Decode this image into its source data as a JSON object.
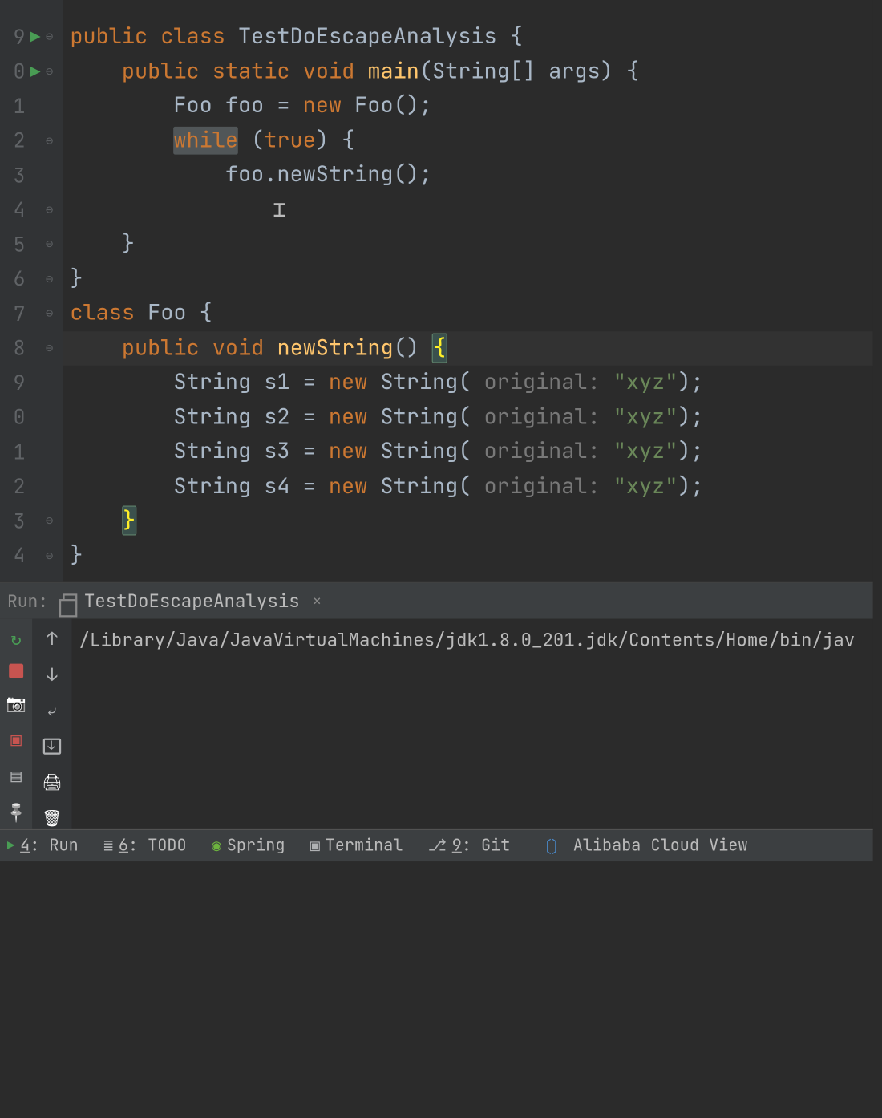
{
  "editor": {
    "lines": [
      {
        "num": "9",
        "run": true,
        "fold": "⊖",
        "tokens": [
          [
            "kw",
            "public"
          ],
          [
            "op",
            " "
          ],
          [
            "kw",
            "class"
          ],
          [
            "op",
            " "
          ],
          [
            "cls",
            "TestDoEscapeAnalysis"
          ],
          [
            "op",
            " {"
          ]
        ]
      },
      {
        "num": "0",
        "run": true,
        "fold": "⊖",
        "tokens": [
          [
            "op",
            "    "
          ],
          [
            "kw",
            "public"
          ],
          [
            "op",
            " "
          ],
          [
            "kw",
            "static"
          ],
          [
            "op",
            " "
          ],
          [
            "kw",
            "void"
          ],
          [
            "op",
            " "
          ],
          [
            "fn",
            "main"
          ],
          [
            "op",
            "(String[] "
          ],
          [
            "param",
            "args"
          ],
          [
            "op",
            ") {"
          ]
        ]
      },
      {
        "num": "1",
        "run": false,
        "fold": "",
        "tokens": [
          [
            "op",
            "        Foo foo = "
          ],
          [
            "kw",
            "new"
          ],
          [
            "op",
            " Foo();"
          ]
        ]
      },
      {
        "num": "2",
        "run": false,
        "fold": "⊖",
        "tokens": [
          [
            "op",
            "        "
          ],
          [
            "kw-while",
            "while"
          ],
          [
            "op",
            " ("
          ],
          [
            "kw",
            "true"
          ],
          [
            "op",
            ") {"
          ]
        ]
      },
      {
        "num": "3",
        "run": false,
        "fold": "",
        "tokens": [
          [
            "op",
            "            foo.newString();"
          ]
        ]
      },
      {
        "num": "4",
        "run": false,
        "fold": "⊖",
        "tokens": [
          [
            "op",
            "        "
          ]
        ]
      },
      {
        "num": "5",
        "run": false,
        "fold": "⊖",
        "tokens": [
          [
            "op",
            "    }"
          ]
        ]
      },
      {
        "num": "6",
        "run": false,
        "fold": "⊖",
        "tokens": [
          [
            "op",
            "}"
          ]
        ]
      },
      {
        "num": "7",
        "run": false,
        "fold": "⊖",
        "tokens": [
          [
            "kw",
            "class"
          ],
          [
            "op",
            " "
          ],
          [
            "cls",
            "Foo"
          ],
          [
            "op",
            " {"
          ]
        ]
      },
      {
        "num": "8",
        "run": false,
        "fold": "⊖",
        "hl": true,
        "tokens": [
          [
            "op",
            "    "
          ],
          [
            "kw",
            "public"
          ],
          [
            "op",
            " "
          ],
          [
            "kw",
            "void"
          ],
          [
            "op",
            " "
          ],
          [
            "fn",
            "newString"
          ],
          [
            "op",
            "() "
          ],
          [
            "brace-match",
            "{"
          ]
        ]
      },
      {
        "num": "9",
        "run": false,
        "fold": "",
        "tokens": [
          [
            "op",
            "        String s1 = "
          ],
          [
            "kw",
            "new"
          ],
          [
            "op",
            " String( "
          ],
          [
            "hint",
            "original: "
          ],
          [
            "str",
            "\"xyz\""
          ],
          [
            "op",
            ");"
          ]
        ]
      },
      {
        "num": "0",
        "run": false,
        "fold": "",
        "tokens": [
          [
            "op",
            "        String s2 = "
          ],
          [
            "kw",
            "new"
          ],
          [
            "op",
            " String( "
          ],
          [
            "hint",
            "original: "
          ],
          [
            "str",
            "\"xyz\""
          ],
          [
            "op",
            ");"
          ]
        ]
      },
      {
        "num": "1",
        "run": false,
        "fold": "",
        "tokens": [
          [
            "op",
            "        String s3 = "
          ],
          [
            "kw",
            "new"
          ],
          [
            "op",
            " String( "
          ],
          [
            "hint",
            "original: "
          ],
          [
            "str",
            "\"xyz\""
          ],
          [
            "op",
            ");"
          ]
        ]
      },
      {
        "num": "2",
        "run": false,
        "fold": "",
        "tokens": [
          [
            "op",
            "        String s4 = "
          ],
          [
            "kw",
            "new"
          ],
          [
            "op",
            " String( "
          ],
          [
            "hint",
            "original: "
          ],
          [
            "str",
            "\"xyz\""
          ],
          [
            "op",
            ");"
          ]
        ]
      },
      {
        "num": "3",
        "run": false,
        "fold": "⊖",
        "tokens": [
          [
            "op",
            "    "
          ],
          [
            "brace-match brace-yellow",
            "}"
          ]
        ]
      },
      {
        "num": "4",
        "run": false,
        "fold": "⊖",
        "tokens": [
          [
            "op",
            "}"
          ]
        ]
      }
    ]
  },
  "run": {
    "label": "Run:",
    "tab": "TestDoEscapeAnalysis",
    "console_line": "/Library/Java/JavaVirtualMachines/jdk1.8.0_201.jdk/Contents/Home/bin/jav"
  },
  "bottom": {
    "items": [
      {
        "icon": "run",
        "label_u": "4",
        "label_rest": ": Run"
      },
      {
        "icon": "list",
        "label_u": "6",
        "label_rest": ": TODO"
      },
      {
        "icon": "spring",
        "label_u": "",
        "label_rest": "Spring"
      },
      {
        "icon": "term",
        "label_u": "",
        "label_rest": "Terminal"
      },
      {
        "icon": "git",
        "label_u": "9",
        "label_rest": ": Git"
      },
      {
        "icon": "brackets",
        "label_u": "",
        "label_rest": "Alibaba Cloud View"
      }
    ]
  }
}
